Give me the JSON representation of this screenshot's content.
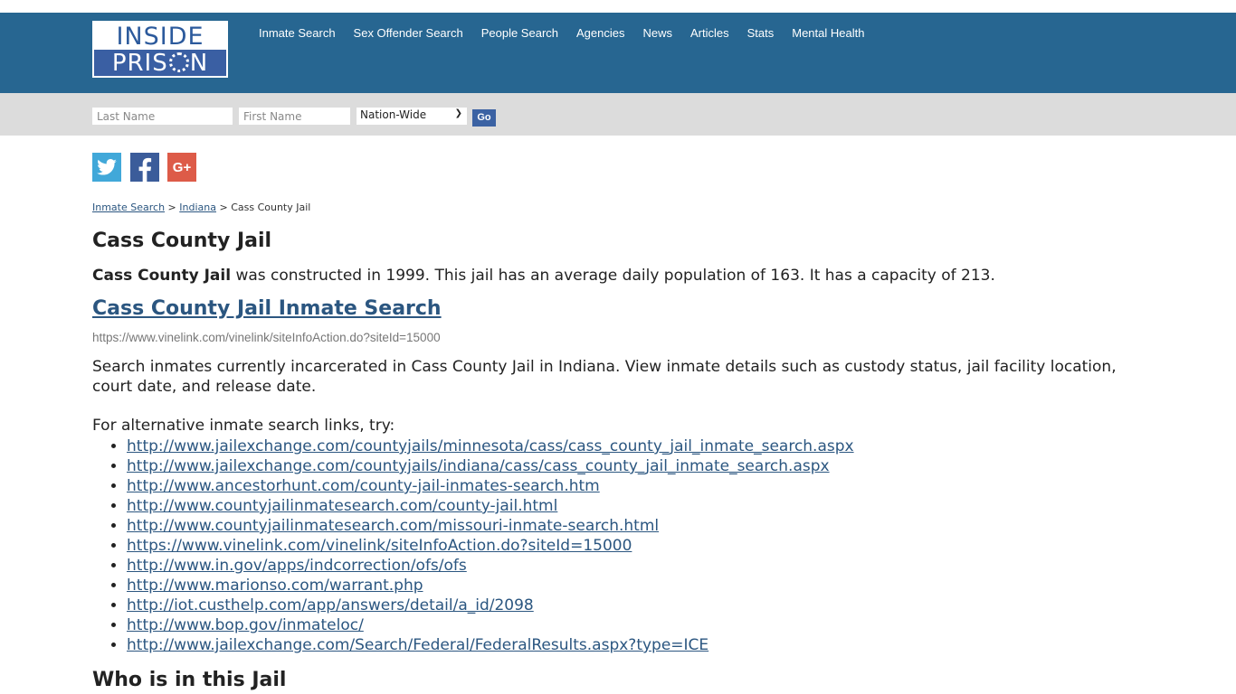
{
  "logo": {
    "line1": "INSIDE",
    "line2_before_o": "PRIS",
    "line2_after_o": "N"
  },
  "nav": [
    {
      "label": "Inmate Search"
    },
    {
      "label": "Sex Offender Search"
    },
    {
      "label": "People Search"
    },
    {
      "label": "Agencies"
    },
    {
      "label": "News"
    },
    {
      "label": "Articles"
    },
    {
      "label": "Stats"
    },
    {
      "label": "Mental Health"
    }
  ],
  "search": {
    "last_placeholder": "Last Name",
    "first_placeholder": "First Name",
    "region_selected": "Nation-Wide",
    "go_label": "Go"
  },
  "social": [
    {
      "name": "twitter",
      "icon": "twitter-icon"
    },
    {
      "name": "facebook",
      "icon": "facebook-icon"
    },
    {
      "name": "google-plus",
      "icon": "google-plus-icon",
      "text": "G+"
    }
  ],
  "breadcrumb": {
    "items": [
      "Inmate Search",
      "Indiana"
    ],
    "separator": ">",
    "current": "Cass County Jail"
  },
  "page": {
    "title": "Cass County Jail",
    "intro_bold": "Cass County Jail",
    "intro_rest": " was constructed in 1999. This jail has an average daily population of 163. It has a capacity of 213.",
    "main_link": "Cass County Jail Inmate Search",
    "main_url": "https://www.vinelink.com/vinelink/siteInfoAction.do?siteId=15000",
    "description": "Search inmates currently incarcerated in Cass County Jail in Indiana. View inmate details such as custody status, jail facility location, court date, and release date.",
    "alt_intro": "For alternative inmate search links, try:",
    "alt_links": [
      "http://www.jailexchange.com/countyjails/minnesota/cass/cass_county_jail_inmate_search.aspx",
      "http://www.jailexchange.com/countyjails/indiana/cass/cass_county_jail_inmate_search.aspx",
      "http://www.ancestorhunt.com/county-jail-inmates-search.htm",
      "http://www.countyjailinmatesearch.com/county-jail.html",
      "http://www.countyjailinmatesearch.com/missouri-inmate-search.html",
      "https://www.vinelink.com/vinelink/siteInfoAction.do?siteId=15000",
      "http://www.in.gov/apps/indcorrection/ofs/ofs",
      "http://www.marionso.com/warrant.php",
      "http://iot.custhelp.com/app/answers/detail/a_id/2098",
      "http://www.bop.gov/inmateloc/",
      "http://www.jailexchange.com/Search/Federal/FederalResults.aspx?type=ICE"
    ],
    "section2_title": "Who is in this Jail"
  },
  "colors": {
    "header_bg": "#276691",
    "searchbar_bg": "#dcdcdc",
    "link": "#2b5680",
    "go_button": "#3b62a3",
    "twitter": "#41a8d9",
    "facebook": "#3b5c9a",
    "google_plus": "#dd5b48"
  }
}
